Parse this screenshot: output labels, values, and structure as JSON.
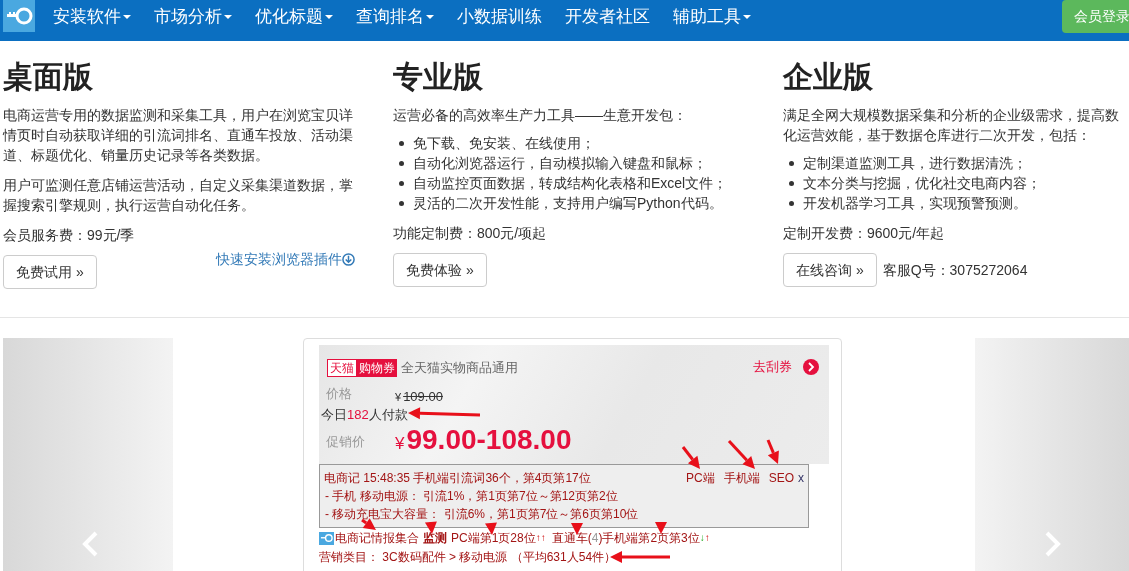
{
  "nav": {
    "items": [
      {
        "label": "安装软件",
        "dropdown": true
      },
      {
        "label": "市场分析",
        "dropdown": true
      },
      {
        "label": "优化标题",
        "dropdown": true
      },
      {
        "label": "查询排名",
        "dropdown": true
      },
      {
        "label": "小数据训练",
        "dropdown": false
      },
      {
        "label": "开发者社区",
        "dropdown": false
      },
      {
        "label": "辅助工具",
        "dropdown": true
      }
    ],
    "login_button": "会员登录"
  },
  "columns": [
    {
      "title": "桌面版",
      "paragraphs": [
        "电商运营专用的数据监测和采集工具，用户在浏览宝贝详情页时自动获取详细的引流词排名、直通车投放、活动渠道、标题优化、销量历史记录等各类数据。",
        "用户可监测任意店铺运营活动，自定义采集渠道数据，掌握搜索引擎规则，执行运营自动化任务。"
      ],
      "fee": "会员服务费：99元/季",
      "button": "免费试用 »",
      "extra": {
        "kind": "link",
        "text": "快速安装浏览器插件"
      }
    },
    {
      "title": "专业版",
      "paragraphs": [
        "运营必备的高效率生产力工具——生意开发包："
      ],
      "bullets": [
        "免下载、免安装、在线使用；",
        "自动化浏览器运行，自动模拟输入键盘和鼠标；",
        "自动监控页面数据，转成结构化表格和Excel文件；",
        "灵活的二次开发性能，支持用户编写Python代码。"
      ],
      "fee": "功能定制费：800元/项起",
      "button": "免费体验 »"
    },
    {
      "title": "企业版",
      "paragraphs": [
        [
          "满足全网大规模数据采集和分析的企业级需求，提高数",
          "化运营效能，基于数据仓库进行二次开发，包括："
        ]
      ],
      "bullets": [
        "定制渠道监测工具，进行数据清洗；",
        "文本分类与挖掘，优化社交电商内容；",
        "开发机器学习工具，实现预警预测。"
      ],
      "fee": "定制开发费：9600元/年起",
      "button": "在线咨询 »",
      "extra": {
        "kind": "text",
        "text": "客服Q号：3075272064"
      }
    }
  ],
  "product": {
    "tags": [
      "天猫",
      "购物券"
    ],
    "coupon_title": "全天猫实物商品通用",
    "coupon_link": "去刮券",
    "price_label": "价格",
    "original_currency": "¥",
    "original_price": "109.00",
    "sales": {
      "prefix": "今日",
      "count": "182",
      "suffix": "人付款"
    },
    "promo_label": "促销价",
    "promo_currency": "¥",
    "promo_price": "99.00-108.00"
  },
  "plugin": {
    "header": "电商记 15:48:35 手机端引流词36个，第4页第17位",
    "tabs": [
      "PC端",
      "手机端",
      "SEO"
    ],
    "close": "x",
    "lines": [
      "- 手机 移动电源： 引流1%，第1页第7位～第12页第2位",
      "- 移动充电宝大容量： 引流6%，第1页第7位～第6页第10位"
    ]
  },
  "summary": [
    {
      "kind": "text",
      "text": "电商记情报集合"
    },
    {
      "kind": "bold",
      "text": "监测"
    },
    {
      "kind": "text",
      "text": "PC端第1页28位"
    },
    {
      "kind": "up",
      "text": "↑↑"
    },
    {
      "kind": "text",
      "text": "直通车("
    },
    {
      "kind": "muted",
      "text": "4"
    },
    {
      "kind": "text",
      "text": ")"
    },
    {
      "kind": "text",
      "text": "手机端第2页第3位"
    },
    {
      "kind": "down",
      "text": "↓"
    },
    {
      "kind": "up",
      "text": "↑"
    }
  ],
  "category": "营销类目： 3C数码配件 > 移动电源 （平均631人54件）"
}
